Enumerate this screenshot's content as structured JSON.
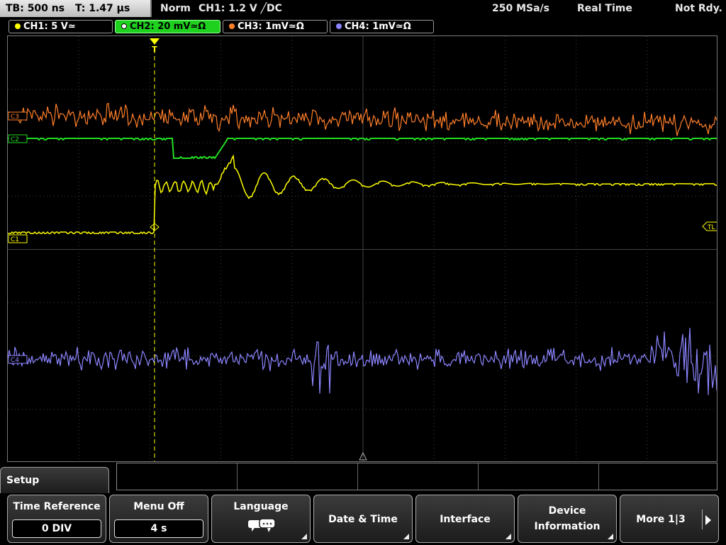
{
  "status": {
    "timebase": "TB: 500 ns",
    "trigger_time": "T: 1.47 µs",
    "trigger_mode": "Norm",
    "trigger_source": "CH1: 1.2 V ╱DC",
    "sample_rate": "250 MSa/s",
    "acq_mode": "Real Time",
    "state": "Not Rdy."
  },
  "channels": [
    {
      "label": "CH1: 5 V≃",
      "color": "#ffff00",
      "active": false
    },
    {
      "label": "CH2: 20 mV≃Ω",
      "color": "#22dd22",
      "active": true
    },
    {
      "label": "CH3: 1mV≃Ω",
      "color": "#ff7f2a",
      "active": false
    },
    {
      "label": "CH4: 1mV≃Ω",
      "color": "#8c85ff",
      "active": false
    }
  ],
  "markers": {
    "c3": "C3",
    "c2": "C2",
    "c1": "C1",
    "c4": "C4",
    "tl": "TL",
    "trigger": "T"
  },
  "colors": {
    "ch1": "#ffff00",
    "ch2": "#22dd22",
    "ch3": "#ff7f2a",
    "ch4": "#8c85ff",
    "grid": "#444444"
  },
  "menu": {
    "title": "Setup",
    "softkeys": [
      {
        "label": "Time Reference",
        "value": "0 DIV"
      },
      {
        "label": "Menu Off",
        "value": "4 s"
      },
      {
        "label": "Language",
        "icon": "speech-bubbles-icon"
      },
      {
        "label": "Date & Time"
      },
      {
        "label": "Interface"
      },
      {
        "label": "Device",
        "label2": "Information"
      },
      {
        "label": "More 1|3"
      }
    ]
  }
}
